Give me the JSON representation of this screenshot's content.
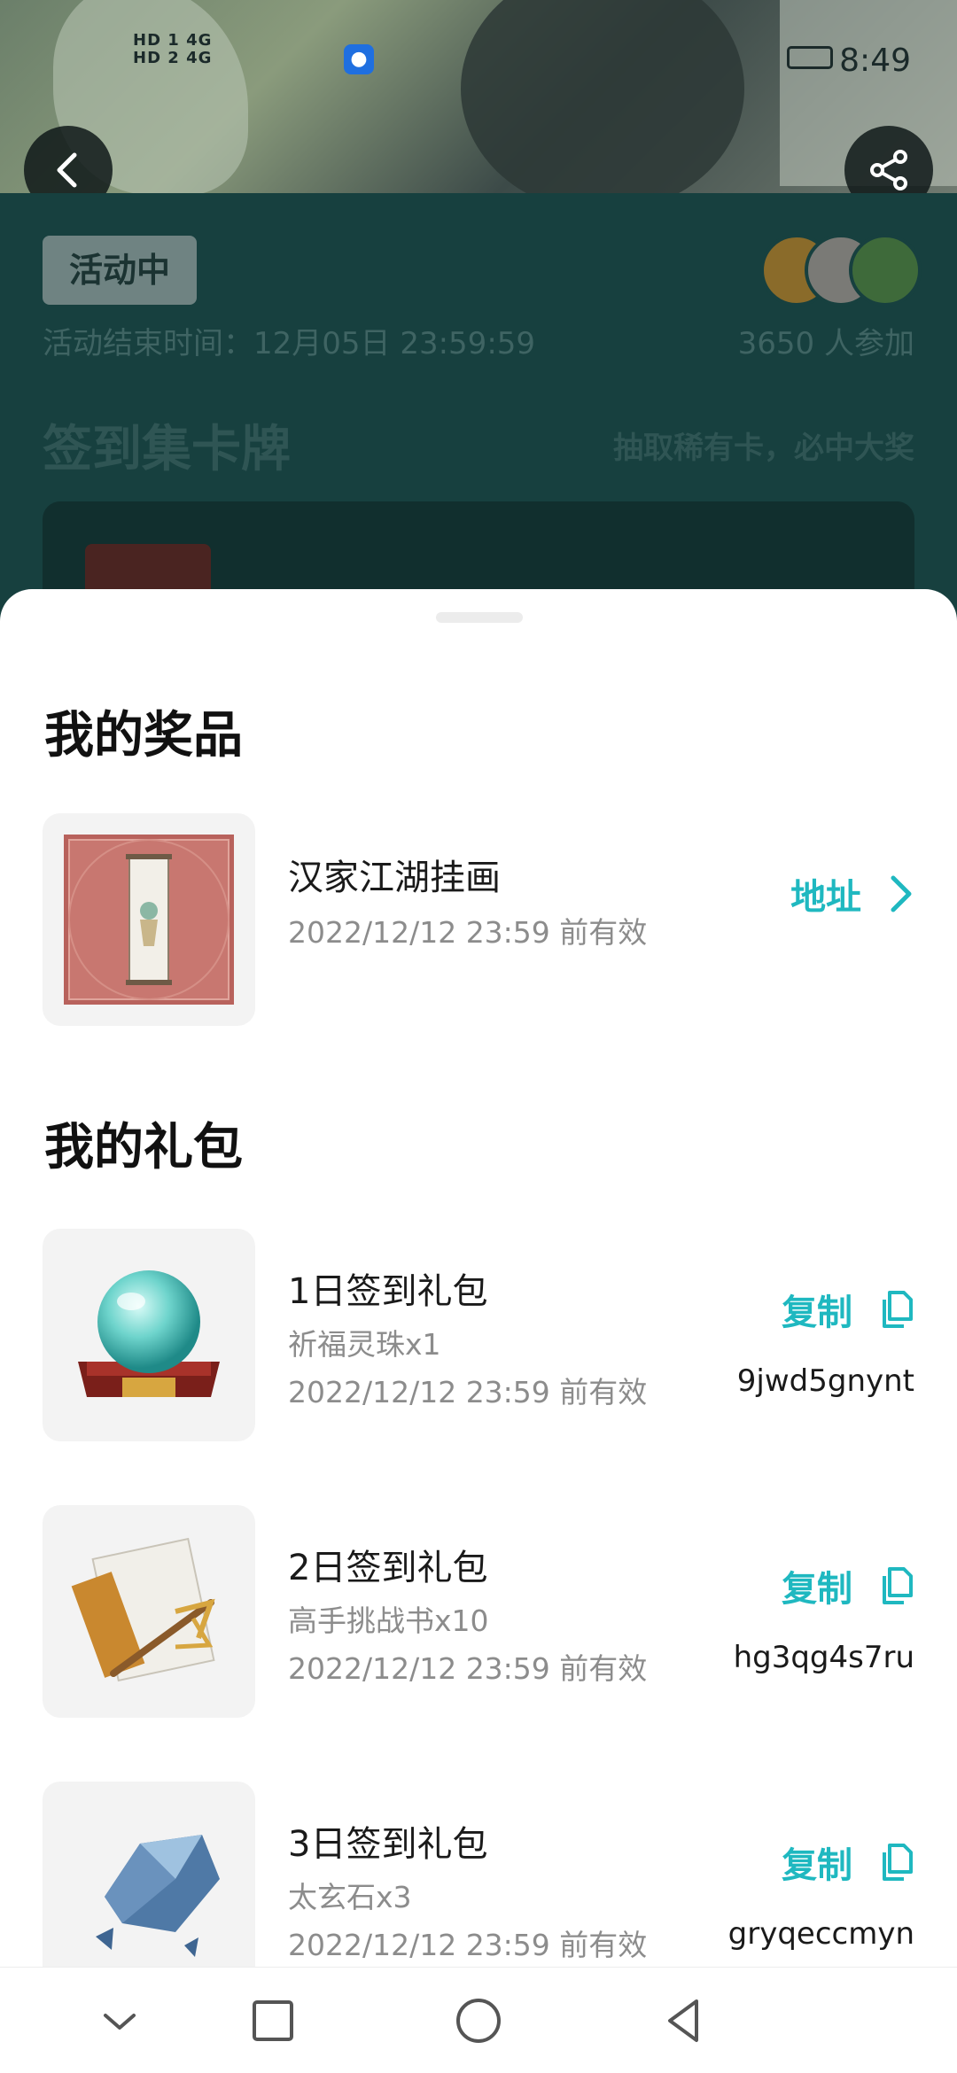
{
  "status_bar": {
    "network_1": "HD 1 4G",
    "network_2": "HD 2 4G",
    "time": "8:49"
  },
  "header": {
    "back_icon": "chevron-left-icon",
    "share_icon": "share-icon"
  },
  "event": {
    "status_badge": "活动中",
    "end_time": "活动结束时间：12月05日 23:59:59",
    "participants": "3650 人参加",
    "section_title": "签到集卡牌",
    "section_subtitle": "抽取稀有卡，必中大奖"
  },
  "prizes": {
    "title": "我的奖品",
    "items": [
      {
        "name": "汉家江湖挂画",
        "valid_until": "2022/12/12 23:59 前有效",
        "action_label": "地址",
        "action_icon": "chevron-right-icon"
      }
    ]
  },
  "gifts": {
    "title": "我的礼包",
    "items": [
      {
        "name": "1日签到礼包",
        "content": "祈福灵珠x1",
        "valid_until": "2022/12/12 23:59 前有效",
        "action_label": "复制",
        "action_icon": "copy-icon",
        "code": "9jwd5gnynt"
      },
      {
        "name": "2日签到礼包",
        "content": "高手挑战书x10",
        "valid_until": "2022/12/12 23:59 前有效",
        "action_label": "复制",
        "action_icon": "copy-icon",
        "code": "hg3qg4s7ru"
      },
      {
        "name": "3日签到礼包",
        "content": "太玄石x3",
        "valid_until": "2022/12/12 23:59 前有效",
        "action_label": "复制",
        "action_icon": "copy-icon",
        "code": "gryqeccmyn"
      }
    ]
  },
  "colors": {
    "accent": "#1fb8c0",
    "overlay_bg": "#17403f",
    "sheet_bg": "#ffffff"
  },
  "navbar": {
    "icons": [
      "chevron-down-icon",
      "square-icon",
      "circle-icon",
      "triangle-back-icon"
    ]
  }
}
